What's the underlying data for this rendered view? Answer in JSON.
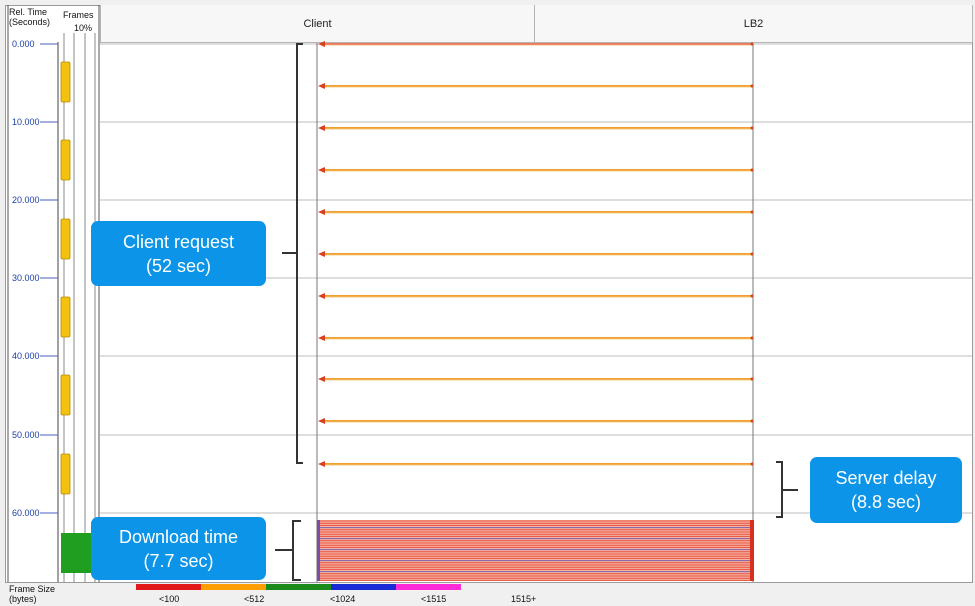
{
  "header": {
    "rel_time_line1": "Rel. Time",
    "rel_time_line2": "(Seconds)",
    "frames_label": "Frames",
    "frames_pct": "10%",
    "columns": [
      "Client",
      "LB2"
    ]
  },
  "time_axis": {
    "ticks": [
      "0.000",
      "10.000",
      "20.000",
      "30.000",
      "40.000",
      "50.000",
      "60.000"
    ]
  },
  "callouts": {
    "client_request": {
      "line1": "Client request",
      "line2": "(52 sec)"
    },
    "server_delay": {
      "line1": "Server delay",
      "line2": "(8.8 sec)"
    },
    "download_time": {
      "line1": "Download time",
      "line2": "(7.7 sec)"
    }
  },
  "legend": {
    "title_line1": "Frame Size",
    "title_line2": "(bytes)",
    "labels": [
      "<100",
      "<512",
      "<1024",
      "<1515",
      "1515+"
    ],
    "colors": [
      "#e31a1a",
      "#ff9e00",
      "#1a8a1a",
      "#1a2bd6",
      "#ff2ad8"
    ]
  },
  "colors": {
    "callout_bg": "#0b94e8",
    "request_arrow": "#f0a030",
    "download_arrow": "#e8503a",
    "frames_bar": "#f2c20f",
    "frames_bar_download": "#1f9e1f"
  }
}
